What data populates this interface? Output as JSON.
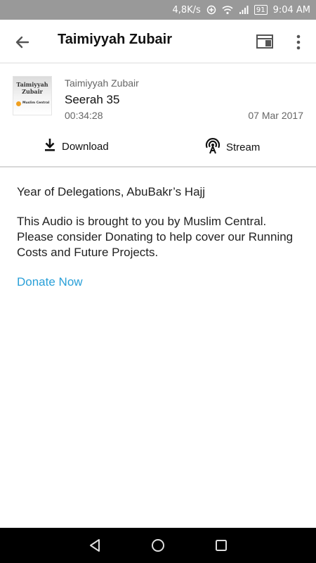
{
  "status_bar": {
    "network_speed": "4,8K/s",
    "battery_level": "91",
    "time": "9:04 AM",
    "icons": [
      "data-saver-icon",
      "wifi-icon",
      "signal-icon",
      "battery-icon"
    ]
  },
  "app_bar": {
    "title": "Taimiyyah Zubair",
    "icons": [
      "back-arrow-icon",
      "window-icon",
      "more-vert-icon"
    ]
  },
  "episode": {
    "thumbnail_title": "Taimiyyah Zubair",
    "thumbnail_brand": "Muslim Central",
    "author": "Taimiyyah Zubair",
    "title": "Seerah 35",
    "duration": "00:34:28",
    "date": "07 Mar 2017",
    "download_label": "Download",
    "stream_label": "Stream"
  },
  "content": {
    "description": "Year of Delegations, AbuBakr’s Hajj",
    "promo": "This Audio is brought to you by Muslim Central. Please consider Donating to help cover our Running Costs and Future Projects.",
    "donate_label": "Donate Now"
  },
  "colors": {
    "status_bar_bg": "#999999",
    "link": "#2aa0d8",
    "nav_bar_bg": "#000000"
  },
  "nav_bar": {
    "icons": [
      "nav-back-icon",
      "nav-home-icon",
      "nav-recents-icon"
    ]
  }
}
